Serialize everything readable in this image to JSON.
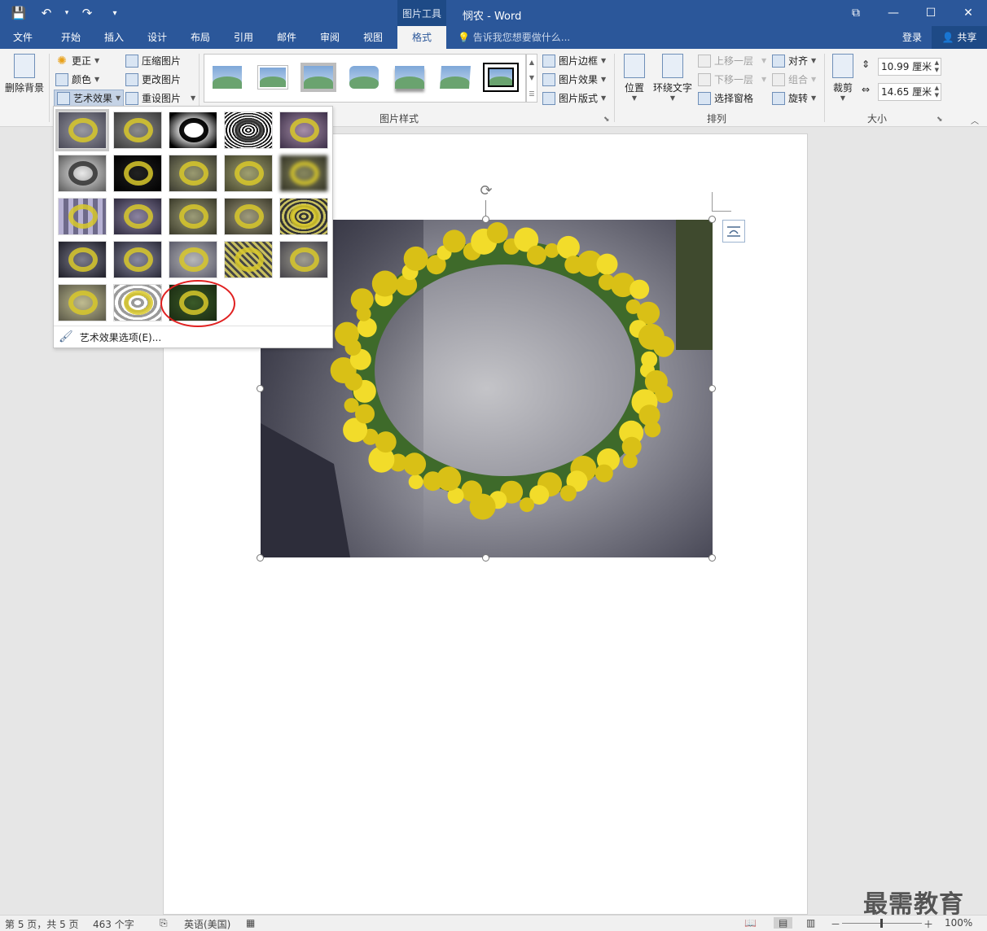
{
  "titlebar": {
    "context_tab": "图片工具",
    "doc_title": "悯农 - Word",
    "qat": {
      "save": "💾",
      "undo": "↶",
      "undo_caret": "▾",
      "redo": "↷",
      "customize": "▾"
    },
    "window_controls": {
      "ribbon_display": "⧉",
      "minimize": "—",
      "maximize": "☐",
      "close": "✕"
    }
  },
  "tabs": [
    "文件",
    "开始",
    "插入",
    "设计",
    "布局",
    "引用",
    "邮件",
    "审阅",
    "视图",
    "格式"
  ],
  "active_tab": "格式",
  "tell_me": "告诉我您想要做什么...",
  "login": "登录",
  "share": "共享",
  "ribbon": {
    "adjust": {
      "remove_bg": "删除背景",
      "corrections": "更正",
      "color": "颜色",
      "artistic_effects": "艺术效果",
      "compress": "压缩图片",
      "change": "更改图片",
      "reset": "重设图片"
    },
    "styles": {
      "label": "图片样式",
      "border": "图片边框",
      "effects": "图片效果",
      "layout": "图片版式"
    },
    "arrange": {
      "label": "排列",
      "position": "位置",
      "wrap": "环绕文字",
      "bring_forward": "上移一层",
      "send_backward": "下移一层",
      "selection_pane": "选择窗格",
      "align": "对齐",
      "group": "组合",
      "rotate": "旋转"
    },
    "size": {
      "label": "大小",
      "crop": "裁剪",
      "height": "10.99 厘米",
      "width": "14.65 厘米"
    }
  },
  "art_effects_menu": {
    "options_label": "艺术效果选项(E)...",
    "selected_index": 0,
    "highlighted_index": 22,
    "effect_count": 23
  },
  "status": {
    "page": "第 5 页，共 5 页",
    "words": "463 个字",
    "language": "英语(美国)",
    "zoom": "100%",
    "zoom_minus": "－",
    "zoom_plus": "＋"
  },
  "watermark": "最需教育"
}
